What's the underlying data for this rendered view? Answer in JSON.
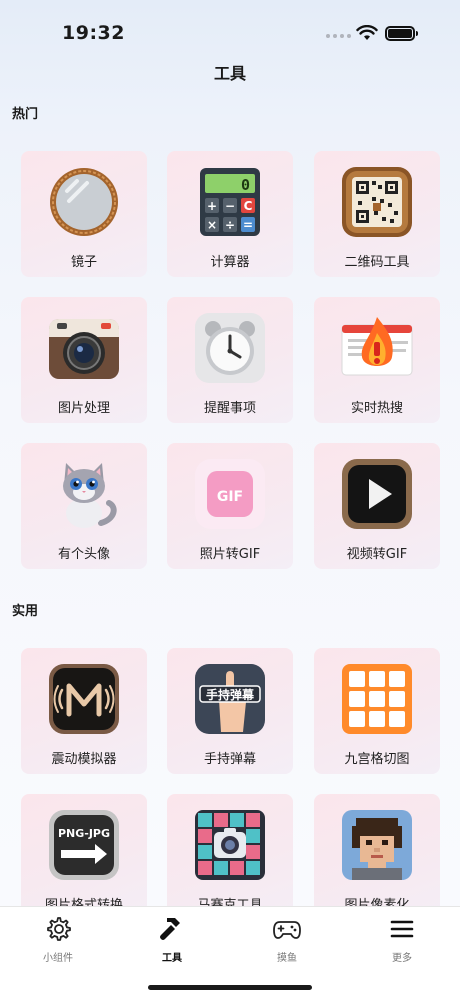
{
  "status_bar": {
    "time": "19:32"
  },
  "header": {
    "title": "工具"
  },
  "sections": [
    {
      "title": "热门",
      "items": [
        {
          "label": "镜子",
          "icon": "mirror-icon"
        },
        {
          "label": "计算器",
          "icon": "calculator-icon"
        },
        {
          "label": "二维码工具",
          "icon": "qr-code-icon"
        },
        {
          "label": "图片处理",
          "icon": "camera-icon"
        },
        {
          "label": "提醒事项",
          "icon": "alarm-clock-icon"
        },
        {
          "label": "实时热搜",
          "icon": "trending-fire-icon"
        },
        {
          "label": "有个头像",
          "icon": "cat-avatar-icon"
        },
        {
          "label": "照片转GIF",
          "icon": "gif-icon",
          "icon_text": "GIF"
        },
        {
          "label": "视频转GIF",
          "icon": "video-play-icon"
        }
      ]
    },
    {
      "title": "实用",
      "items": [
        {
          "label": "震动模拟器",
          "icon": "vibration-icon"
        },
        {
          "label": "手持弹幕",
          "icon": "handheld-danmaku-icon",
          "icon_text": "手持弹幕"
        },
        {
          "label": "九宫格切图",
          "icon": "grid-nine-icon"
        },
        {
          "label": "图片格式转换",
          "icon": "format-convert-icon",
          "icon_text": "PNG-JPG"
        },
        {
          "label": "马赛克工具",
          "icon": "mosaic-icon"
        },
        {
          "label": "图片像素化",
          "icon": "pixel-portrait-icon"
        }
      ]
    }
  ],
  "tabbar": [
    {
      "label": "小组件",
      "icon": "gear-icon",
      "active": false
    },
    {
      "label": "工具",
      "icon": "hammer-icon",
      "active": true
    },
    {
      "label": "摸鱼",
      "icon": "gamepad-icon",
      "active": false
    },
    {
      "label": "更多",
      "icon": "menu-icon",
      "active": false
    }
  ],
  "colors": {
    "tile_bg": "#fbe6ec",
    "accent_orange": "#ff8a2a",
    "gif_pink": "#f49cc4"
  }
}
